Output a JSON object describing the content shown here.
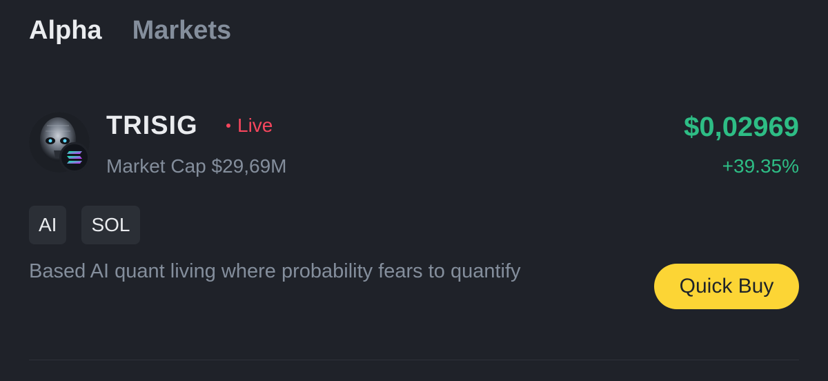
{
  "tabs": [
    {
      "label": "Alpha",
      "active": true
    },
    {
      "label": "Markets",
      "active": false
    }
  ],
  "token": {
    "name": "TRISIG",
    "status": "Live",
    "market_cap_label": "Market Cap $29,69M",
    "price": "$0,02969",
    "change": "+39.35%",
    "avatar_icon": "skull-avatar-icon",
    "chain_icon": "solana-icon",
    "tags": [
      "AI",
      "SOL"
    ],
    "description": "Based AI quant living where probability fears to quantify",
    "quick_buy_label": "Quick Buy"
  },
  "colors": {
    "background": "#1f2229",
    "positive": "#2ebd85",
    "live": "#f6465d",
    "accent_button": "#fcd535",
    "muted_text": "#848e9c"
  }
}
